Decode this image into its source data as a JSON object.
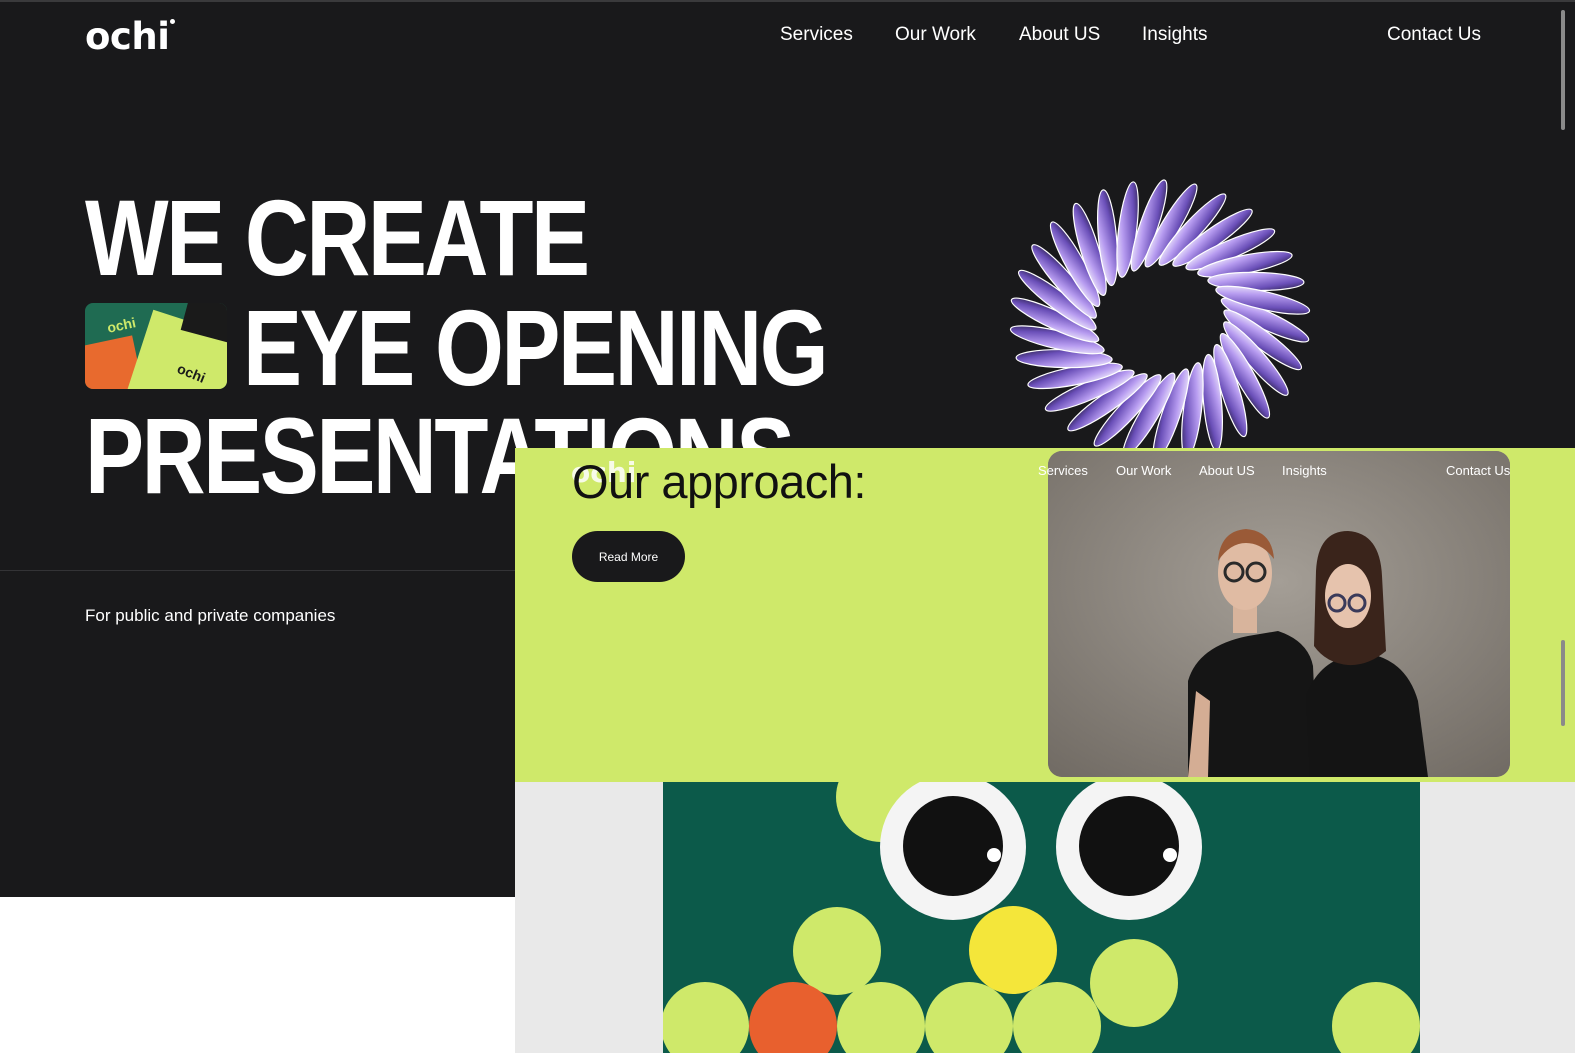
{
  "brand": {
    "logo": "ochi"
  },
  "nav": {
    "services": "Services",
    "our_work": "Our Work",
    "about": "About US",
    "insights": "Insights",
    "contact": "Contact Us"
  },
  "hero": {
    "line1": "WE CREATE",
    "line2": "EYE OPENING",
    "line3": "PRESENTATIONS",
    "thumb_logo_a": "ochi",
    "thumb_logo_b": "ochi",
    "tagline": "For public and private companies"
  },
  "approach": {
    "ghost_logo": "ochi",
    "title": "Our approach:",
    "read_more": "Read More",
    "mini_nav": {
      "services": "Services",
      "our_work": "Our Work",
      "about": "About US",
      "insights": "Insights",
      "contact": "Contact Us"
    }
  },
  "colors": {
    "dark": "#19191b",
    "lime": "#cfe96a",
    "green": "#0c5a4a",
    "orange": "#e8602e",
    "yellow": "#f4e63a"
  }
}
